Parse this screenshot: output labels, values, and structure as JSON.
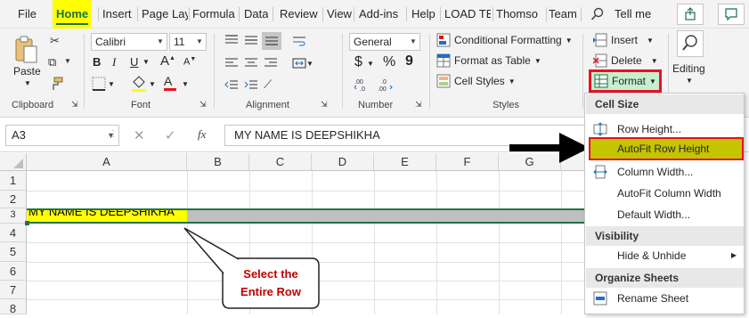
{
  "menu": {
    "tabs": [
      "File",
      "Home",
      "Insert",
      "Page Lay",
      "Formula",
      "Data",
      "Review",
      "View",
      "Add-ins",
      "Help",
      "LOAD TE",
      "Thomso",
      "Team"
    ],
    "tell_me": "Tell me"
  },
  "ribbon": {
    "clipboard": {
      "paste": "Paste",
      "label": "Clipboard"
    },
    "font": {
      "name": "Calibri",
      "size": "11",
      "bold": "B",
      "italic": "I",
      "underline": "U",
      "grow": "A",
      "shrink": "A",
      "fontcolor_glyph": "A",
      "label": "Font"
    },
    "alignment": {
      "label": "Alignment"
    },
    "number": {
      "format": "General",
      "currency": "$",
      "percent": "%",
      "comma": "9",
      "label": "Number"
    },
    "styles": {
      "conditional": "Conditional Formatting",
      "format_table": "Format as Table",
      "cell_styles": "Cell Styles",
      "label": "Styles"
    },
    "cells": {
      "insert": "Insert",
      "delete": "Delete",
      "format": "Format"
    },
    "editing": {
      "label": "Editing"
    }
  },
  "formula_bar": {
    "name_box": "A3",
    "fx": "fx",
    "content": "MY NAME IS DEEPSHIKHA"
  },
  "grid": {
    "columns": [
      "A",
      "B",
      "C",
      "D",
      "E",
      "F",
      "G"
    ],
    "rows": [
      "1",
      "2",
      "3",
      "4",
      "5",
      "6",
      "7",
      "8"
    ],
    "cell_a3": "MY NAME IS DEEPSHIKHA"
  },
  "callout": {
    "line1": "Select the",
    "line2": "Entire Row"
  },
  "dropdown": {
    "cell_size": "Cell Size",
    "row_height": "Row Height...",
    "autofit_row": "AutoFit Row Height",
    "column_width": "Column Width...",
    "autofit_col": "AutoFit Column Width",
    "default_width": "Default Width...",
    "visibility": "Visibility",
    "hide_unhide": "Hide & Unhide",
    "organize": "Organize Sheets",
    "rename": "Rename Sheet"
  },
  "colors": {
    "highlight_yellow": "#ffff00",
    "excel_green": "#1e7145",
    "red_border": "#e81123",
    "autofit_fill": "#c4c400",
    "callout_text": "#c00000",
    "selected_row": "#bfbfbf"
  }
}
